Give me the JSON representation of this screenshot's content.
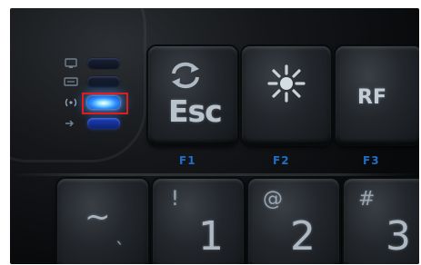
{
  "photo": {
    "subject": "keyboard"
  },
  "keys": {
    "esc": {
      "label": "Esc",
      "icon": "refresh-icon"
    },
    "brightness": {
      "icon": "sun-icon"
    },
    "rf": {
      "label": "RF"
    },
    "tilde": {
      "upper": "~",
      "lower": "`"
    },
    "one": {
      "upper": "!",
      "lower": "1"
    },
    "two": {
      "upper": "@",
      "lower": "2"
    },
    "three": {
      "upper": "#",
      "lower": "3"
    }
  },
  "function_labels": {
    "f1": "F1",
    "f2": "F2",
    "f3": "F3"
  },
  "leds": [
    {
      "icon": "monitor-icon",
      "state": "off"
    },
    {
      "icon": "keyboard-icon",
      "state": "off"
    },
    {
      "icon": "wireless-icon",
      "state": "bright-on"
    },
    {
      "icon": "arrow-icon",
      "state": "on"
    }
  ],
  "colors": {
    "led_active": "#2a8cff",
    "highlight_box": "#e21b1b",
    "fn_label": "#1f6fc9"
  }
}
